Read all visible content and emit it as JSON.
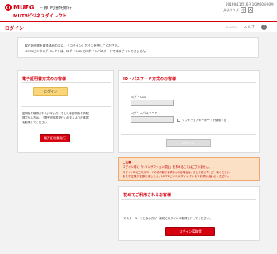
{
  "header": {
    "brand": "MUFG",
    "bank_name": "三菱UFJ信託銀行",
    "service_name": "MUTBビジネスダイレクト",
    "datetime": "2016年11月16日 10時00分00秒",
    "font_size_label": "文字サイズ",
    "font_size_small": "小",
    "font_size_large": "大"
  },
  "titlebar": {
    "title": "ログイン",
    "screen_id": "BLG0001",
    "help_label": "ヘルプ",
    "help_icon": "?"
  },
  "intro": {
    "line1": "電子証明書を取得済みの方は、「ログイン」ボタンを押してください。",
    "line2": "MUTBビジネスダイレクトは、ログインID とログインパスワードではログインできません。"
  },
  "cert_panel": {
    "title": "電子証明書方式のお客様",
    "login_button": "ログイン",
    "text1": "証明書を取得されていない方、もしくは証明書を再取",
    "text2": "得される方は、「電子証明書発行」ボタンより証明書",
    "text3": "を取得してください。",
    "issue_button": "電子証明書発行"
  },
  "idpw_panel": {
    "title": "ID・パスワード方式のお客様",
    "login_id_label": "ログインID",
    "login_id_value": "",
    "password_label": "ログインパスワード",
    "password_value": "",
    "software_keyboard_label": "ソフトウェアキーボードを使用する",
    "login_button": "ログイン"
  },
  "notice": {
    "title": "ご注意",
    "line1": "ログイン時に「トランザクション認証」を求めることはございません。",
    "line2": "ログイン時に二次元コードの読み取りを求められる場合は、決して応じず、ご一報ください。",
    "line3": "また不正操作を感じましたら、MUTBビジネスダイレクトまでお問い合わせください。"
  },
  "first_user": {
    "title": "初めてご利用されるお客様",
    "text": "マスターユーザとなる方が、最初にログインID取得を行ってください。",
    "button": "ログインID取得"
  },
  "colors": {
    "brand_red": "#d7000f",
    "yellow_button": "#f9d67a",
    "notice_bg": "#fbe0c6"
  }
}
